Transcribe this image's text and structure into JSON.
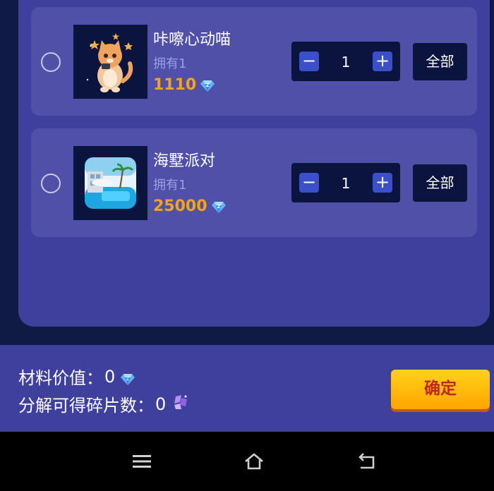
{
  "items": [
    {
      "name": "咔嚓心动喵",
      "owned": "拥有1",
      "price": "1110",
      "quantity": "1",
      "all_label": "全部"
    },
    {
      "name": "海墅派对",
      "owned": "拥有1",
      "price": "25000",
      "quantity": "1",
      "all_label": "全部"
    }
  ],
  "stepper": {
    "minus_symbol": "−",
    "plus_symbol": "+"
  },
  "footer": {
    "material_value_label": "材料价值：",
    "material_value": "0",
    "fragments_label": "分解可得碎片数：",
    "fragments_value": "0",
    "confirm_label": "确定"
  },
  "icons": {
    "diamond": "diamond-icon",
    "fragment": "fragment-icon",
    "menu": "menu-icon",
    "home": "home-icon",
    "back": "back-icon"
  },
  "colors": {
    "background": "#0f1a45",
    "panel": "#3f3f9e",
    "card": "#5050a8",
    "price": "#f5a418",
    "owned": "#9a9ee6",
    "confirm_button": "#ffc20e",
    "confirm_text": "#c0261a"
  }
}
